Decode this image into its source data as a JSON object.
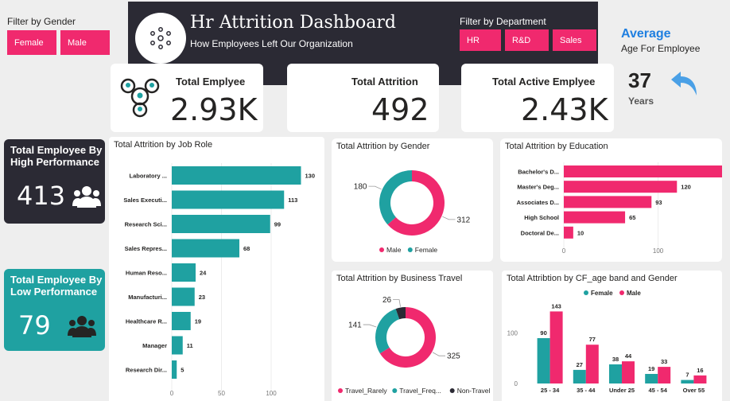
{
  "filters": {
    "gender_label": "Filter by Gender",
    "gender_options": [
      "Female",
      "Male"
    ],
    "department_label": "Filter by Department",
    "department_options": [
      "HR",
      "R&D",
      "Sales"
    ]
  },
  "header": {
    "title": "Hr Attrition Dashboard",
    "subtitle": "How Employees Left Our Organization"
  },
  "kpis": {
    "total_employee": {
      "label": "Total Emplyee",
      "value": "2.93K"
    },
    "total_attrition": {
      "label": "Total Attrition",
      "value": "492"
    },
    "total_active": {
      "label": "Total Active Emplyee",
      "value": "2.43K"
    }
  },
  "average_age": {
    "title": "Average",
    "subtitle": "Age For Employee",
    "value": "37",
    "unit": "Years"
  },
  "side_cards": {
    "high": {
      "title": "Total Employee By High Performance",
      "value": "413"
    },
    "low": {
      "title": "Total Employee By Low Performance",
      "value": "79"
    }
  },
  "colors": {
    "pink": "#f0296e",
    "teal": "#1fa1a1",
    "dark": "#2b2a34"
  },
  "chart_data": [
    {
      "id": "job_role",
      "type": "bar",
      "orientation": "horizontal",
      "title": "Total Attrition by Job Role",
      "categories": [
        "Laboratory ...",
        "Sales Executi...",
        "Research Sci...",
        "Sales Repres...",
        "Human Reso...",
        "Manufacturi...",
        "Healthcare R...",
        "Manager",
        "Research Dir..."
      ],
      "values": [
        130,
        113,
        99,
        68,
        24,
        23,
        19,
        11,
        5
      ],
      "xticks": [
        0,
        50,
        100
      ],
      "xlim": [
        0,
        140
      ]
    },
    {
      "id": "gender",
      "type": "pie",
      "donut": true,
      "title": "Total Attrition by Gender",
      "labels": [
        "Male",
        "Female"
      ],
      "values": [
        312,
        180
      ],
      "legend": [
        "Male",
        "Female"
      ]
    },
    {
      "id": "education",
      "type": "bar",
      "orientation": "horizontal",
      "title": "Total Attrition by Education",
      "categories": [
        "Bachelor's D...",
        "Master's Deg...",
        "Associates D...",
        "High School",
        "Doctoral De..."
      ],
      "values": [
        204,
        120,
        93,
        65,
        10
      ],
      "xticks": [
        0,
        100,
        200
      ],
      "xlim": [
        0,
        210
      ]
    },
    {
      "id": "business_travel",
      "type": "pie",
      "donut": true,
      "title": "Total Attrition by Business Travel",
      "labels": [
        "Travel_Rarely",
        "Travel_Freq...",
        "Non-Travel"
      ],
      "values": [
        325,
        141,
        26
      ],
      "legend": [
        "Travel_Rarely",
        "Travel_Freq...",
        "Non-Travel"
      ]
    },
    {
      "id": "age_band",
      "type": "bar",
      "title": "Total Attribtion by CF_age band and Gender",
      "categories": [
        "25 - 34",
        "35 - 44",
        "Under 25",
        "45 - 54",
        "Over 55"
      ],
      "series": [
        {
          "name": "Female",
          "values": [
            90,
            27,
            38,
            19,
            7
          ]
        },
        {
          "name": "Male",
          "values": [
            143,
            77,
            44,
            33,
            16
          ]
        }
      ],
      "yticks": [
        0,
        100
      ],
      "ylim": [
        0,
        150
      ],
      "legend": [
        "Female",
        "Male"
      ]
    }
  ]
}
